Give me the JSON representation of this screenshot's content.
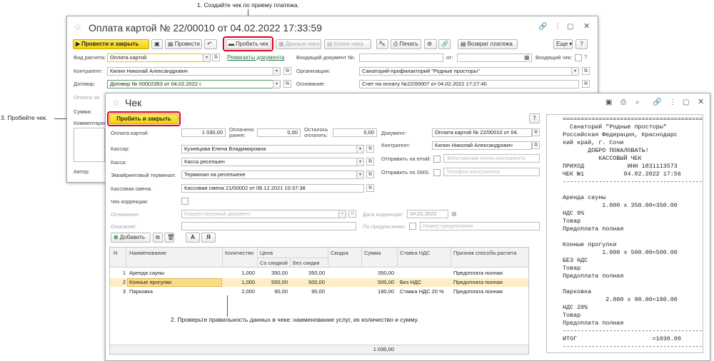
{
  "annotations": {
    "step1": "1. Создайте чек по приему платежа.",
    "step2": "2. Проверьте правильность данных в чеке: наименование услуг, их количество и сумму.",
    "step3": "3. Пробейте чек."
  },
  "payment": {
    "title": "Оплата картой № 22/00010 от 04.02.2022 17:33:59",
    "toolbar": {
      "post_close": "Провести и закрыть",
      "post": "Провести",
      "print_check": "Пробить чек",
      "check_data": "Данные чека",
      "check_copy": "Копия чека",
      "print": "Печать",
      "refund": "Возврат платежа",
      "more": "Еще",
      "help": "?"
    },
    "calc_type_label": "Вид расчета:",
    "calc_type_value": "Оплата картой",
    "requisites_link": "Реквизиты документа",
    "incoming_doc_label": "Входящий документ №:",
    "from_label": "от:",
    "date_placeholder": ". .",
    "incoming_check_label": "Входящий чек:",
    "counterparty_label": "Контрагент:",
    "counterparty_value": "Килин Николай Александрович",
    "organization_label": "Организация:",
    "organization_value": "Санаторий-профилакторий \"Родные просторы\"",
    "contract_label": "Договор:",
    "contract_value": "Договор № 00002353 от 04.02.2022 г.",
    "basis_label": "Основание:",
    "basis_value": "Счет на оплату №22/00007 от 04.02.2022 17:27:40",
    "paid_for_label": "Оплата за:",
    "sum_label": "Сумма:",
    "comment_label": "Комментарий:",
    "author_label": "Автор:"
  },
  "check": {
    "title": "Чек",
    "print_close": "Пробить и закрыть",
    "help": "?",
    "card_payment_label": "Оплата картой:",
    "card_payment_value": "1 030,00",
    "paid_before_label": "Оплачено ранее:",
    "paid_before_value": "0,00",
    "remaining_label": "Осталось оплатить:",
    "remaining_value": "0,00",
    "document_label": "Документ:",
    "document_value": "Оплата картой № 22/00010 от 04.",
    "cashier_label": "Кассир:",
    "cashier_value": "Кузнецова Елена Владимировна",
    "counterparty_label": "Контрагент:",
    "counterparty_value": "Килин Николай Александрович",
    "register_label": "Касса:",
    "register_value": "Касса ресепшен",
    "send_email_label": "Отправить на email:",
    "email_placeholder": "Электронная почта контрагента",
    "terminal_label": "Эквайринговый терминал:",
    "terminal_value": "Терминал на ресепшене",
    "send_sms_label": "Отправить по SMS:",
    "phone_placeholder": "Телефон контрагента",
    "shift_label": "Кассовая смена:",
    "shift_value": "Кассовая смена 21/00002 от 08.12.2021 10:37:38",
    "correction_label": "Чек коррекции:",
    "basis_label": "Основание:",
    "basis_placeholder": "Корректируемый документ",
    "correction_date_label": "Дата коррекции:",
    "correction_date_value": "04.02.2022",
    "description_label": "Описание:",
    "by_order_label": "По предписанию:",
    "order_placeholder": "Номер предписания",
    "add_button": "Добавить",
    "font_a": "А",
    "font_ya": "Я",
    "columns": {
      "n": "N",
      "name": "Наименование",
      "qty": "Количество",
      "price": "Цена",
      "with_discount": "Со скидкой",
      "no_discount": "Без скидки",
      "discount": "Скидка",
      "sum": "Сумма",
      "vat": "Ставка НДС",
      "method": "Признак способа расчета"
    },
    "rows": [
      {
        "n": "1",
        "name": "Аренда сауны",
        "qty": "1,000",
        "with_discount": "350,00",
        "no_discount": "350,00",
        "discount": "",
        "sum": "350,00",
        "vat": "",
        "method": "Предоплата полная"
      },
      {
        "n": "2",
        "name": "Конные прогулки",
        "qty": "1,000",
        "with_discount": "500,00",
        "no_discount": "500,00",
        "discount": "",
        "sum": "500,00",
        "vat": "Без НДС",
        "method": "Предоплата полная"
      },
      {
        "n": "3",
        "name": "Парковка",
        "qty": "2,000",
        "with_discount": "90,00",
        "no_discount": "90,00",
        "discount": "",
        "sum": "180,00",
        "vat": "Ставка НДС 20 %",
        "method": "Предоплата полная"
      }
    ],
    "total": "1 030,00"
  },
  "receipt": {
    "lines": [
      "=========================================",
      "  Санаторий \"Родные просторы\"",
      "Российская Федерация, Краснодарс",
      "кий край, г. Сочи",
      "       ДОБРО ПОЖАЛОВАТЬ!",
      "          КАССОВЫЙ ЧЕК",
      "ПРИХОД            ИНН 1831113573",
      "ЧЕК №1           04.02.2022 17:56",
      "-----------------------------------------",
      "",
      "Аренда сауны",
      "           1.000 x 350.00=350.00",
      "НДС 0%",
      "Товар",
      "Предоплата полная",
      "",
      "Конные прогулки",
      "           1.000 x 500.00=500.00",
      "БЕЗ НДС",
      "Товар",
      "Предоплата полная",
      "",
      "Парковка",
      "            2.000 x 90.00=180.00",
      "НДС 20%",
      "Товар",
      "Предоплата полная",
      "-----------------------------------------",
      "ИТОГ                     =1030.00",
      "-----------------------------------------"
    ]
  }
}
